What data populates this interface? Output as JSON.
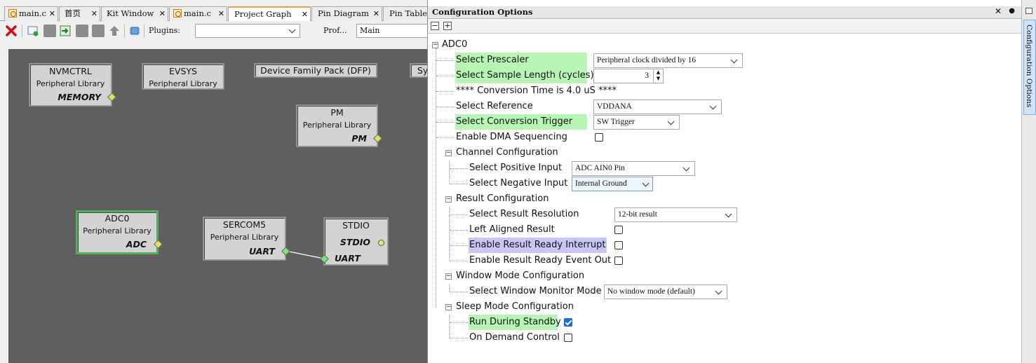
{
  "editor_tabs": [
    {
      "label": "main.c",
      "icon": "c-file-icon"
    },
    {
      "label": "首页",
      "icon": ""
    },
    {
      "label": "Kit Window",
      "icon": ""
    },
    {
      "label": "main.c",
      "icon": "c-file-icon"
    },
    {
      "label": "Project Graph",
      "icon": "",
      "active": true
    },
    {
      "label": "Pin Diagram",
      "icon": ""
    },
    {
      "label": "Pin Table",
      "icon": ""
    }
  ],
  "tab_close_glyph": "✕",
  "toolbar": {
    "plugins_label": "Plugins:",
    "plugins_value": "",
    "profile_label": "Prof...",
    "profile_value": "Main"
  },
  "graph": {
    "nodes": {
      "nvmctrl": {
        "title": "NVMCTRL",
        "subtitle": "Peripheral Library",
        "cap": "MEMORY"
      },
      "evsys": {
        "title": "EVSYS",
        "subtitle": "Peripheral Library"
      },
      "dfp": {
        "title": "Device Family Pack (DFP)"
      },
      "sys": {
        "title": "Sy"
      },
      "pm": {
        "title": "PM",
        "subtitle": "Peripheral Library",
        "cap": "PM"
      },
      "adc0": {
        "title": "ADC0",
        "subtitle": "Peripheral Library",
        "cap": "ADC"
      },
      "sercom5": {
        "title": "SERCOM5",
        "subtitle": "Peripheral Library",
        "cap": "UART"
      },
      "stdio": {
        "title": "STDIO",
        "cap_top": "STDIO",
        "cap_bottom": "UART"
      }
    },
    "colors": {
      "canvas": "#5f5f5f",
      "selected_border": "#3fbf3f",
      "consumer": "#e0e060",
      "provider": "#7ee07e"
    }
  },
  "config": {
    "title": "Configuration Options",
    "root": "ADC0",
    "rows": {
      "prescaler": {
        "label": "Select Prescaler",
        "value": "Peripheral clock divided by 16"
      },
      "sample_length": {
        "label": "Select Sample Length (cycles)",
        "value": "3"
      },
      "conversion_time": {
        "label": "**** Conversion Time is 4.0 uS ****"
      },
      "reference": {
        "label": "Select Reference",
        "value": "VDDANA"
      },
      "trigger": {
        "label": "Select Conversion Trigger",
        "value": "SW Trigger"
      },
      "dma": {
        "label": "Enable DMA Sequencing",
        "checked": false
      },
      "channel_cfg": {
        "label": "Channel Configuration"
      },
      "pos_input": {
        "label": "Select Positive Input",
        "value": "ADC AIN0 Pin"
      },
      "neg_input": {
        "label": "Select Negative Input",
        "value": "Internal Ground"
      },
      "result_cfg": {
        "label": "Result Configuration"
      },
      "resolution": {
        "label": "Select Result Resolution",
        "value": "12-bit result"
      },
      "left_aligned": {
        "label": "Left Aligned Result",
        "checked": false
      },
      "ready_interrupt": {
        "label": "Enable Result Ready Interrupt",
        "checked": false
      },
      "ready_event": {
        "label": "Enable Result Ready Event Out",
        "checked": false
      },
      "window_cfg": {
        "label": "Window Mode Configuration"
      },
      "window_mode": {
        "label": "Select Window Monitor Mode",
        "value": "No window mode (default)"
      },
      "sleep_cfg": {
        "label": "Sleep Mode Configuration"
      },
      "standby": {
        "label": "Run During Standby",
        "checked": true
      },
      "on_demand": {
        "label": "On Demand Control",
        "checked": false
      }
    },
    "highlight_colors": {
      "changed": "#b7f5b5",
      "selected": "#c9c5f5"
    }
  },
  "sidebar": {
    "tab_label": "Configuration Options"
  }
}
